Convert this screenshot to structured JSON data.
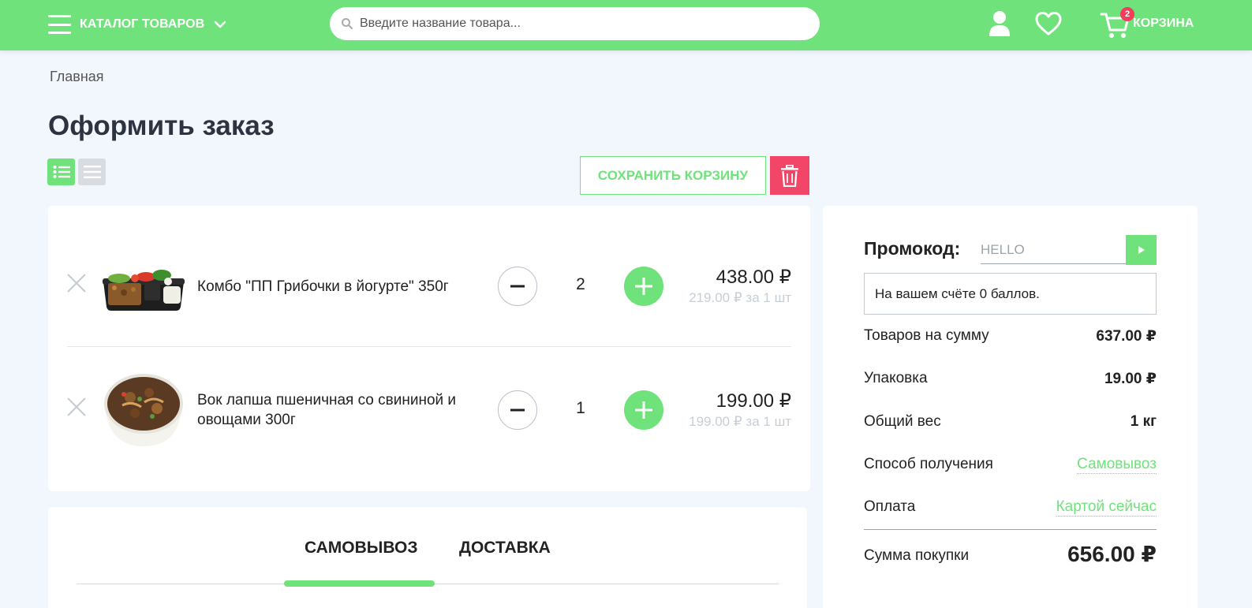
{
  "header": {
    "catalog_label": "КАТАЛОГ ТОВАРОВ",
    "search_placeholder": "Введите название товара...",
    "cart_count": "2",
    "cart_label": "КОРЗИНА"
  },
  "breadcrumb": "Главная",
  "page_title": "Оформить заказ",
  "toolbar": {
    "save_label": "СОХРАНИТЬ КОРЗИНУ"
  },
  "cart_items": [
    {
      "name": "Комбо \"ПП Грибочки в йогурте\" 350г",
      "quantity": "2",
      "total": "438.00 ₽",
      "unit_price": "219.00 ₽",
      "unit_suffix": "за 1 шт"
    },
    {
      "name": "Вок лапша пшеничная со свининой и овощами 300г",
      "quantity": "1",
      "total": "199.00 ₽",
      "unit_price": "199.00 ₽",
      "unit_suffix": "за 1 шт"
    }
  ],
  "delivery_tabs": [
    "САМОВЫВОЗ",
    "ДОСТАВКА"
  ],
  "summary": {
    "promo_label": "Промокод:",
    "promo_value": "HELLO",
    "points_text": "На вашем счёте 0 баллов.",
    "goods_label": "Товаров на сумму",
    "goods_value": "637.00 ₽",
    "pack_label": "Упаковка",
    "pack_value": "19.00 ₽",
    "weight_label": "Общий вес",
    "weight_value": "1 кг",
    "pickup_label": "Способ получения",
    "pickup_value": "Самовывоз",
    "payment_label": "Оплата",
    "payment_value": "Картой сейчас",
    "total_label": "Сумма покупки",
    "total_value": "656.00 ₽"
  },
  "colors": {
    "accent": "#6fe27b",
    "danger": "#f24668",
    "badge": "#f23d5b"
  }
}
